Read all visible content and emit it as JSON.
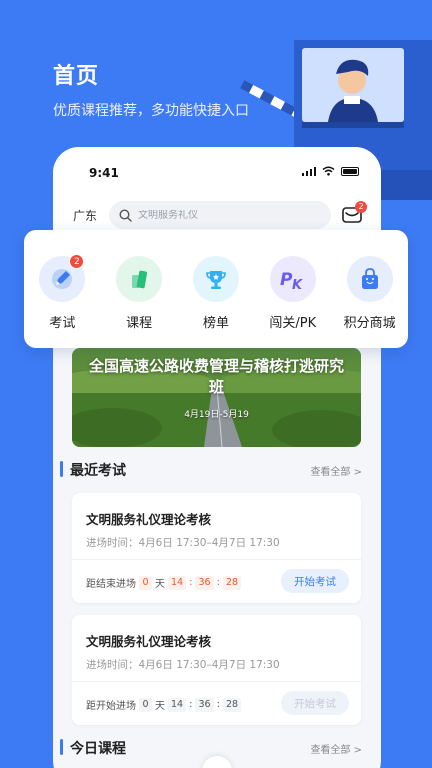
{
  "hero": {
    "title": "首页",
    "subtitle": "优质课程推荐，多功能快捷入口"
  },
  "status_bar": {
    "time": "9:41"
  },
  "header": {
    "region": "广东",
    "search_placeholder": "文明服务礼仪",
    "message_badge": "2"
  },
  "categories": [
    {
      "label": "考试",
      "icon": "exam-pen-icon",
      "badge": "2",
      "color": "#3d7bf4"
    },
    {
      "label": "课程",
      "icon": "course-book-icon",
      "color": "#27c07a"
    },
    {
      "label": "榜单",
      "icon": "trophy-icon",
      "color": "#2fb3f0"
    },
    {
      "label": "闯关/PK",
      "icon": "pk-icon",
      "color": "#6b5cf0"
    },
    {
      "label": "积分商城",
      "icon": "shopping-bag-icon",
      "color": "#3d7bf4"
    }
  ],
  "banner": {
    "title": "全国高速公路收费管理与稽核打逃研究班",
    "date": "4月19日-5月19"
  },
  "recent_exams": {
    "title": "最近考试",
    "view_all": "查看全部 >",
    "items": [
      {
        "name": "文明服务礼仪理论考核",
        "time": "进场时间：4月6日 17:30–4月7日 17:30",
        "countdown_label": "距结束进场",
        "days": "0",
        "day_unit": "天",
        "hours": "14",
        "minutes": "36",
        "seconds": "28",
        "button": "开始考试",
        "button_enabled": true
      },
      {
        "name": "文明服务礼仪理论考核",
        "time": "进场时间：4月6日 17:30–4月7日 17:30",
        "countdown_label": "距开始进场",
        "days": "0",
        "day_unit": "天",
        "hours": "14",
        "minutes": "36",
        "seconds": "28",
        "button": "开始考试",
        "button_enabled": false
      }
    ]
  },
  "today_courses": {
    "title": "今日课程",
    "view_all": "查看全部 >"
  },
  "colors": {
    "background": "#3d7bf4",
    "accent": "#3d7bf4",
    "countdown_red": "#f2542d",
    "badge_red": "#f24b3e"
  }
}
